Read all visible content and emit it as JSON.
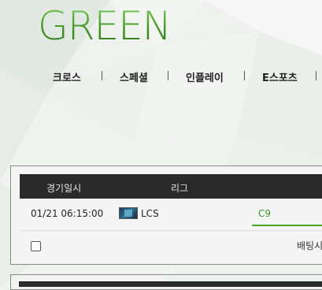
{
  "brand": {
    "logo_text": "GREEN",
    "accent_color": "#4aa12c"
  },
  "nav": {
    "items": [
      {
        "label": "크로스"
      },
      {
        "label": "스페셜"
      },
      {
        "label": "인플레이"
      },
      {
        "label": "E스포츠"
      }
    ]
  },
  "table": {
    "headers": {
      "date": "경기일시",
      "league": "리그"
    },
    "rows": [
      {
        "date": "01/21 06:15:00",
        "league_icon": "lcs-league-icon",
        "league": "LCS",
        "team": "C9"
      }
    ],
    "footer": {
      "bet_label": "배팅시"
    }
  }
}
